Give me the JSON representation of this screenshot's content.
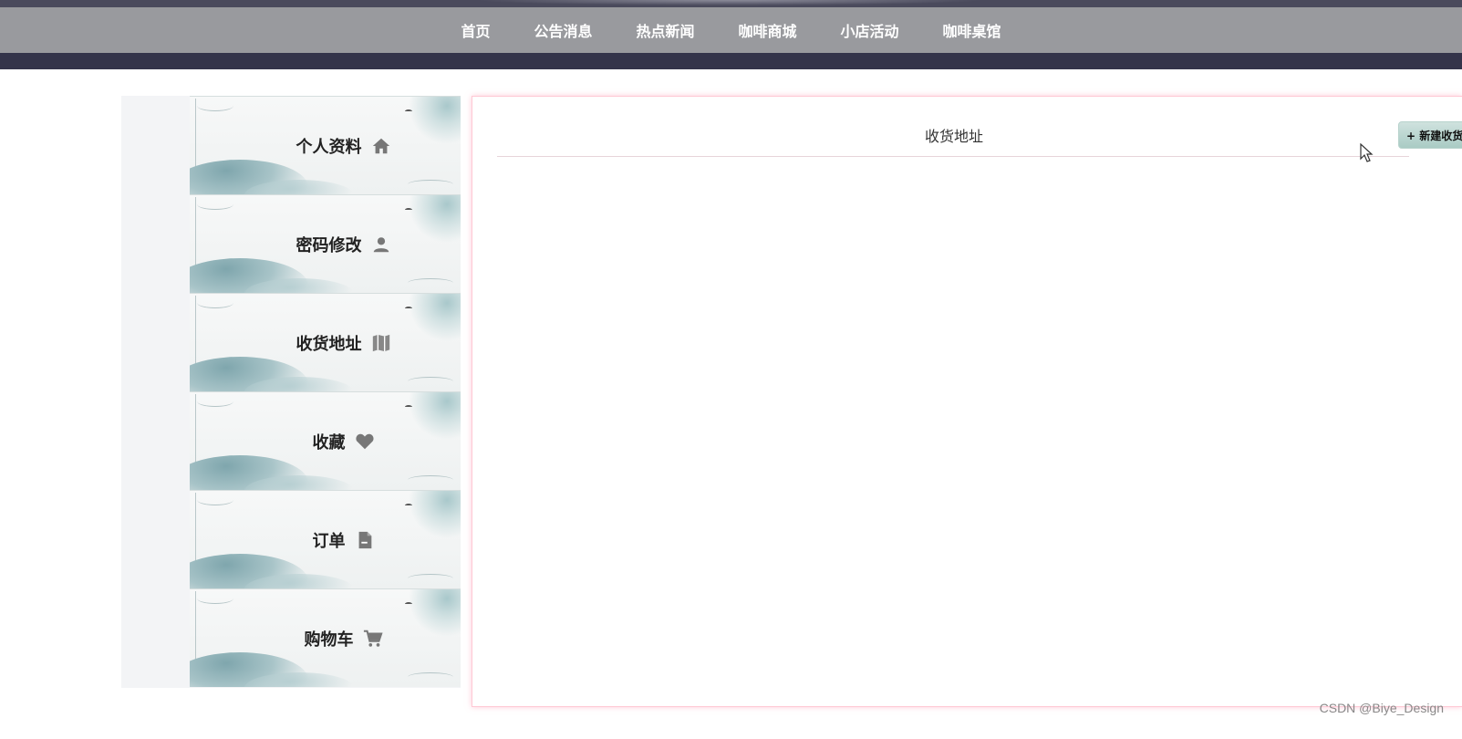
{
  "nav": {
    "items": [
      "首页",
      "公告消息",
      "热点新闻",
      "咖啡商城",
      "小店活动",
      "咖啡桌馆"
    ]
  },
  "sidebar": {
    "items": [
      {
        "label": "个人资料",
        "icon": "home-icon"
      },
      {
        "label": "密码修改",
        "icon": "user-icon"
      },
      {
        "label": "收货地址",
        "icon": "map-icon"
      },
      {
        "label": "收藏",
        "icon": "heart-icon"
      },
      {
        "label": "订单",
        "icon": "document-icon"
      },
      {
        "label": "购物车",
        "icon": "cart-icon"
      }
    ]
  },
  "main": {
    "title": "收货地址",
    "new_button_label": "+ 新建收货"
  },
  "watermark": "CSDN @Biye_Design",
  "colors": {
    "nav_bg": "#999a9e",
    "dark_band": "#34344a",
    "panel_border": "#ffc8d4",
    "button_bg": "#a9cbc4"
  }
}
